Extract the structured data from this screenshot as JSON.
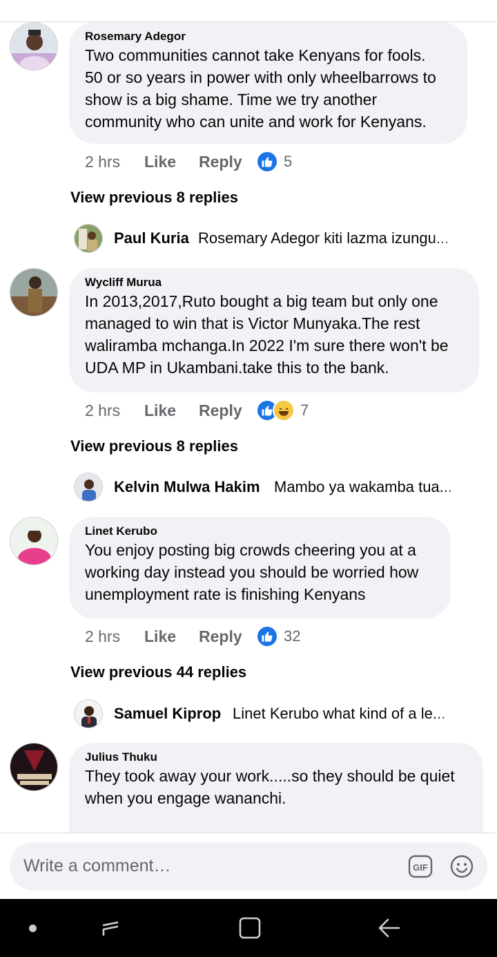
{
  "comments": [
    {
      "author": "Rosemary Adegor",
      "lines": [
        "Two communities cannot  take Kenyans for fools.",
        "50 or so years in power with only wheelbarrows to",
        "show is a big shame. Time we try another",
        "community who can unite and work for Kenyans."
      ],
      "time": "2 hrs",
      "like_label": "Like",
      "reply_label": "Reply",
      "reaction_count": "5",
      "reactions": [
        "like-icon"
      ],
      "view_previous": "View previous 8 replies",
      "latest_reply": {
        "author": "Paul Kuria",
        "text": "Rosemary Adegor kiti lazma izungu..."
      }
    },
    {
      "author": "Wycliff Murua",
      "lines": [
        "In 2013,2017,Ruto bought a big team but only  one",
        "managed to win that is Victor Munyaka.The rest",
        "waliramba mchanga.In 2022 I'm sure there won't be",
        "UDA MP in Ukambani.take this to the bank."
      ],
      "time": "2 hrs",
      "like_label": "Like",
      "reply_label": "Reply",
      "reaction_count": "7",
      "reactions": [
        "like-icon",
        "haha-icon"
      ],
      "view_previous": "View previous 8 replies",
      "latest_reply": {
        "author": "Kelvin Mulwa Hakim",
        "text": "Mambo ya wakamba tua..."
      }
    },
    {
      "author": "Linet Kerubo",
      "lines": [
        "You enjoy posting big crowds cheering you at a",
        "working day instead you should be worried how",
        "unemployment rate is finishing Kenyans"
      ],
      "time": "2 hrs",
      "like_label": "Like",
      "reply_label": "Reply",
      "reaction_count": "32",
      "reactions": [
        "like-icon"
      ],
      "view_previous": "View previous 44 replies",
      "latest_reply": {
        "author": "Samuel Kiprop",
        "text": "Linet Kerubo what kind of a le..."
      }
    },
    {
      "author": "Julius Thuku",
      "lines": [
        "They took away your work.....so they should be quiet",
        "when you engage wananchi."
      ]
    }
  ],
  "composer": {
    "placeholder": "Write a comment…",
    "gif_label": "GIF"
  },
  "colors": {
    "bubble": "#f0f2f5",
    "like_blue": "#1b74e4",
    "secondary_text": "#65676b",
    "nav_bar": "#000000"
  }
}
